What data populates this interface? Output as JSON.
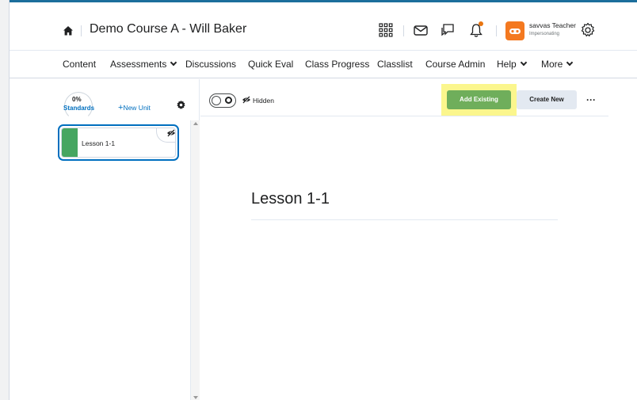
{
  "header": {
    "course_title": "Demo Course A - Will Baker",
    "user_name": "savvas Teacher",
    "user_status": "Impersonating",
    "icons": [
      "home-icon",
      "waffle-icon",
      "mail-icon",
      "chat-icon",
      "bell-icon",
      "settings-icon"
    ],
    "notification_color": "#e87511",
    "avatar_color": "#f47920"
  },
  "nav": {
    "items": [
      {
        "label": "Content",
        "dropdown": false
      },
      {
        "label": "Assessments",
        "dropdown": true
      },
      {
        "label": "Discussions",
        "dropdown": false
      },
      {
        "label": "Quick Eval",
        "dropdown": false
      },
      {
        "label": "Class Progress",
        "dropdown": false
      },
      {
        "label": "Classlist",
        "dropdown": false
      },
      {
        "label": "Course Admin",
        "dropdown": false
      },
      {
        "label": "Help",
        "dropdown": true
      },
      {
        "label": "More",
        "dropdown": true
      }
    ]
  },
  "sidebar": {
    "standards_percent": "0%",
    "standards_label": "Standards",
    "new_unit_plus": "+",
    "new_unit_label": "New Unit",
    "units": [
      {
        "label": "Lesson 1-1",
        "color": "#46a661",
        "hidden": true
      }
    ]
  },
  "toolbar": {
    "visibility_label": "Hidden",
    "add_existing_label": "Add Existing",
    "create_new_label": "Create New",
    "more_label": "···",
    "primary_color": "#6fae5b",
    "highlight_color": "#fbf68d"
  },
  "main": {
    "lesson_title": "Lesson 1-1"
  }
}
